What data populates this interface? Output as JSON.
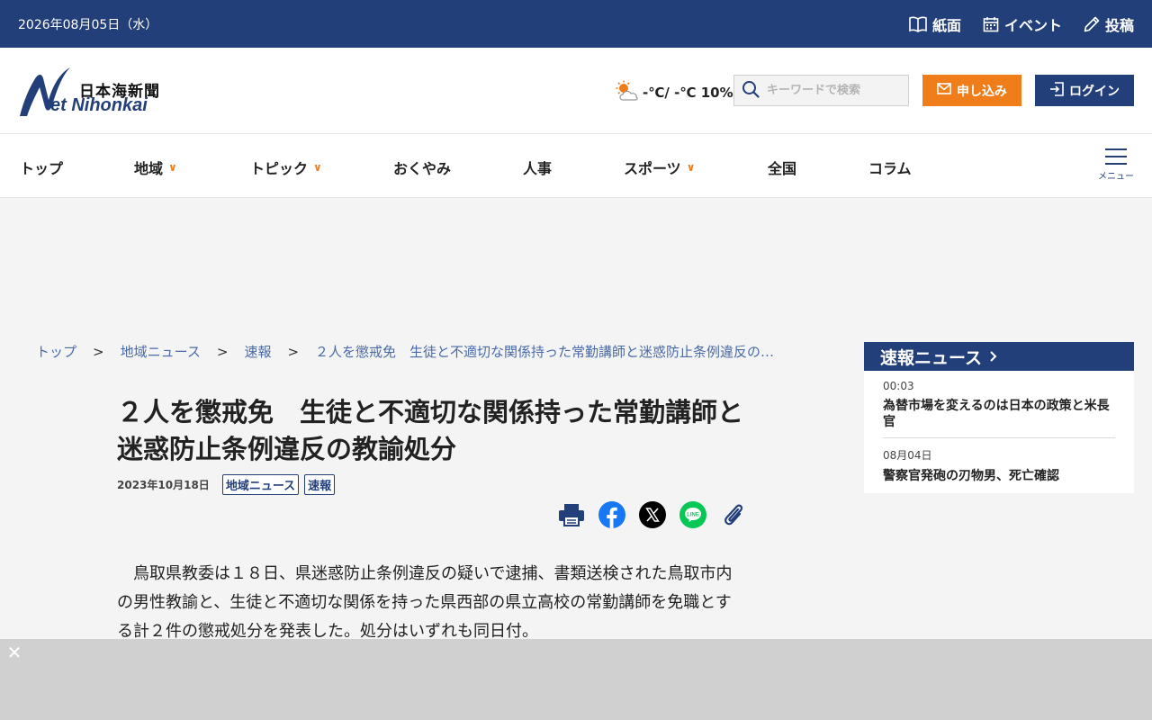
{
  "topbar": {
    "date": "2026年08月05日（水）",
    "links": [
      {
        "label": "紙面",
        "icon": "book-icon"
      },
      {
        "label": "イベント",
        "icon": "calendar-icon"
      },
      {
        "label": "投稿",
        "icon": "pen-icon"
      }
    ]
  },
  "header": {
    "logo": {
      "jp": "日本海新聞",
      "en": "et Nihonkai"
    },
    "weather": {
      "icon": "partly-cloudy-icon",
      "text": "-℃/ -℃ 10%"
    },
    "search": {
      "placeholder": "キーワードで検索"
    },
    "apply_label": "申し込み",
    "login_label": "ログイン"
  },
  "nav": {
    "items": [
      {
        "label": "トップ",
        "dropdown": false
      },
      {
        "label": "地域",
        "dropdown": true
      },
      {
        "label": "トピック",
        "dropdown": true
      },
      {
        "label": "おくやみ",
        "dropdown": false
      },
      {
        "label": "人事",
        "dropdown": false
      },
      {
        "label": "スポーツ",
        "dropdown": true
      },
      {
        "label": "全国",
        "dropdown": false
      },
      {
        "label": "コラム",
        "dropdown": false
      }
    ],
    "menu_label": "メニュー"
  },
  "breadcrumb": {
    "items": [
      "トップ",
      "地域ニュース",
      "速報",
      "２人を懲戒免　生徒と不適切な関係持った常勤講師と迷惑防止条例違反の…"
    ],
    "separator": ">"
  },
  "article": {
    "title": "２人を懲戒免　生徒と不適切な関係持った常勤講師と迷惑防止条例違反の教諭処分",
    "date": "2023年10月18日",
    "tags": [
      "地域ニュース",
      "速報"
    ],
    "share": [
      "print-icon",
      "facebook-icon",
      "x-icon",
      "line-icon",
      "link-icon"
    ],
    "body": "　鳥取県教委は１８日、県迷惑防止条例違反の疑いで逮捕、書類送検された鳥取市内の男性教諭と、生徒と不適切な関係を持った県西部の県立高校の常勤講師を免職とする計２件の懲戒処分を発表した。処分はいずれも同日付。"
  },
  "sidebar": {
    "heading": "速報ニュース",
    "entries": [
      {
        "time": "00:03",
        "headline": "為替市場を変えるのは日本の政策と米長官"
      },
      {
        "time": "08月04日",
        "headline": "警察官発砲の刃物男、死亡確認"
      }
    ]
  },
  "colors": {
    "navy": "#233f79",
    "orange": "#ef7d1a",
    "background": "#f4f4f4"
  }
}
